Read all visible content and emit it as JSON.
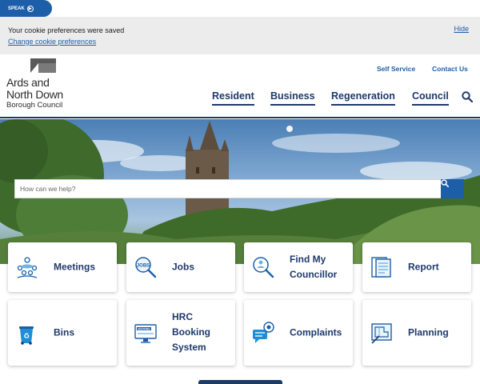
{
  "speak": {
    "label": "SPEAK",
    "icon": "play-circle-icon"
  },
  "cookie": {
    "message": "Your cookie preferences were saved",
    "change_link": "Change cookie preferences",
    "hide_link": "Hide"
  },
  "logo": {
    "line1": "Ards and",
    "line2": "North Down",
    "line3": "Borough Council"
  },
  "utility_links": {
    "self_service": "Self Service",
    "contact_us": "Contact Us"
  },
  "nav": {
    "resident": "Resident",
    "business": "Business",
    "regeneration": "Regeneration",
    "council": "Council"
  },
  "search": {
    "placeholder": "How can we help?"
  },
  "tiles": [
    {
      "label": "Meetings",
      "icon": "meeting-people-icon"
    },
    {
      "label": "Jobs",
      "icon": "jobs-magnifier-icon"
    },
    {
      "label": "Find My Councillor",
      "icon": "find-person-icon"
    },
    {
      "label": "Report",
      "icon": "report-document-icon"
    },
    {
      "label": "Bins",
      "icon": "recycle-bin-icon"
    },
    {
      "label": "HRC Booking System",
      "icon": "booking-screen-icon"
    },
    {
      "label": "Complaints",
      "icon": "complaint-chat-icon"
    },
    {
      "label": "Planning",
      "icon": "planning-blueprint-icon"
    }
  ],
  "colors": {
    "primary_blue": "#1c5fa8",
    "navy": "#1e3a6b",
    "cookie_bg": "#ececec"
  }
}
